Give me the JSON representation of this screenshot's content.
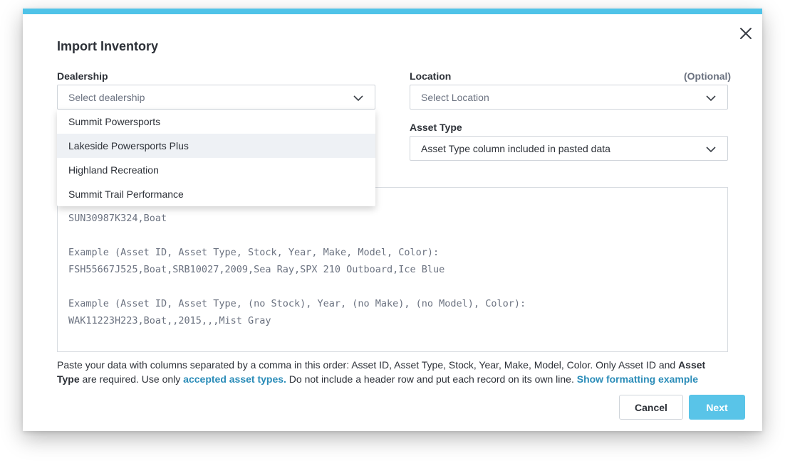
{
  "modal": {
    "title": "Import Inventory",
    "accent_color": "#4fc3e8",
    "close_icon": "close-icon"
  },
  "dealership": {
    "label": "Dealership",
    "placeholder": "Select dealership",
    "options": [
      "Summit Powersports",
      "Lakeside Powersports Plus",
      "Highland Recreation",
      "Summit Trail Performance"
    ],
    "highlighted_option": "Lakeside Powersports Plus"
  },
  "location": {
    "label": "Location",
    "optional_label": "(Optional)",
    "placeholder": "Select Location"
  },
  "asset_type": {
    "label": "Asset Type",
    "value": "Asset Type column included in pasted data"
  },
  "paste_area": {
    "lines": [
      "SUN30987K324,Boat",
      "",
      "Example (Asset ID, Asset Type, Stock, Year, Make, Model, Color):",
      "FSH55667J525,Boat,SRB10027,2009,Sea Ray,SPX 210 Outboard,Ice Blue",
      "",
      "Example (Asset ID, Asset Type, (no Stock), Year, (no Make), (no Model), Color):",
      "WAK11223H223,Boat,,2015,,,Mist Gray"
    ]
  },
  "help": {
    "part1": "Paste your data with columns separated by a comma in this order: Asset ID, Asset Type, Stock, Year, Make, Model, Color. Only Asset ID and ",
    "bold1": "Asset Type",
    "part2": " are required. Use only ",
    "link1": "accepted asset types.",
    "part3": " Do not include a header row and put each record on its own line. ",
    "link2": "Show formatting example"
  },
  "buttons": {
    "cancel": "Cancel",
    "next": "Next",
    "next_color": "#59c4e8"
  }
}
